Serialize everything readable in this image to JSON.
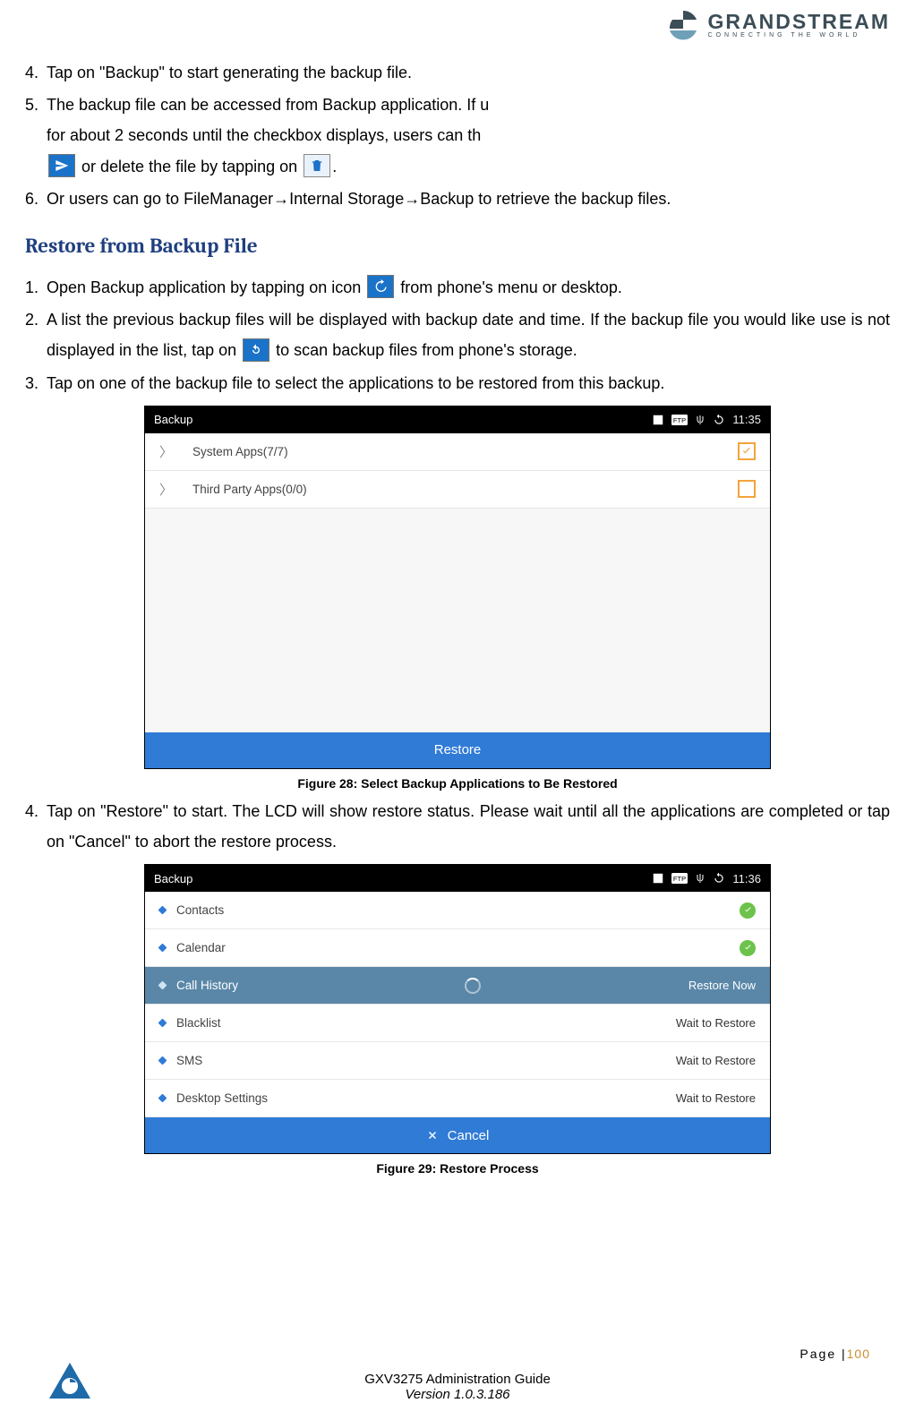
{
  "brand": {
    "name": "GRANDSTREAM",
    "tagline": "CONNECTING THE WORLD"
  },
  "list1": {
    "i4": "Tap on \"Backup\" to start generating the backup file.",
    "i5a": "The backup file can be accessed from Backup application. If u",
    "i5b": "for about 2 seconds until the checkbox displays, users can th",
    "i5c": " or delete the file by tapping on ",
    "i5d": ".",
    "i6": "Or users can go to FileManager→Internal Storage→Backup to retrieve the backup files."
  },
  "sectionTitle": "Restore from Backup File",
  "list2": {
    "i1a": "Open Backup application by tapping on icon ",
    "i1b": " from phone's menu or desktop.",
    "i2a": "A list the previous backup files will be displayed with backup date and time. If the backup file you would like use is not displayed in the list, tap on ",
    "i2b": " to scan backup files from phone's storage.",
    "i3": "Tap on one of the backup file to select the applications to be restored from this backup."
  },
  "fig28": {
    "title": "Backup",
    "time": "11:35",
    "rows": [
      {
        "label": "System Apps(7/7)",
        "checked": true
      },
      {
        "label": "Third Party Apps(0/0)",
        "checked": false
      }
    ],
    "button": "Restore",
    "caption": "Figure 28: Select Backup Applications to Be Restored"
  },
  "list3": {
    "i4": "Tap on \"Restore\" to start. The LCD will show restore status. Please wait until all the applications are completed or tap on \"Cancel\" to abort the restore process."
  },
  "fig29": {
    "title": "Backup",
    "time": "11:36",
    "rows": [
      {
        "label": "Contacts",
        "status": "done"
      },
      {
        "label": "Calendar",
        "status": "done"
      },
      {
        "label": "Call History",
        "status": "now",
        "end": "Restore Now"
      },
      {
        "label": "Blacklist",
        "status": "wait",
        "end": "Wait to Restore"
      },
      {
        "label": "SMS",
        "status": "wait",
        "end": "Wait to Restore"
      },
      {
        "label": "Desktop Settings",
        "status": "wait",
        "end": "Wait to Restore"
      }
    ],
    "button": "Cancel",
    "caption": "Figure 29: Restore Process"
  },
  "footer": {
    "pageLabel": "Page |",
    "pageNum": "100",
    "line1": "GXV3275 Administration Guide",
    "line2": "Version 1.0.3.186"
  }
}
